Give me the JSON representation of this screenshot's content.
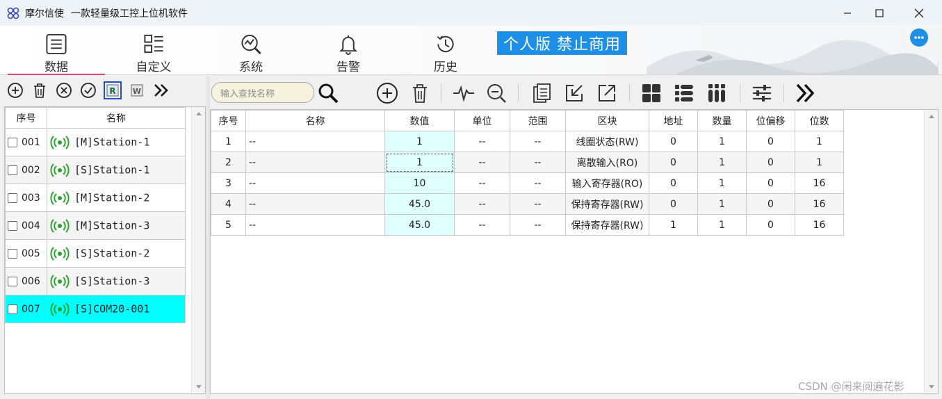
{
  "window": {
    "title": "摩尔信使",
    "subtitle": "一款轻量级工控上位机软件",
    "controls": [
      "minimize",
      "maximize",
      "close"
    ]
  },
  "nav": {
    "items": [
      {
        "label": "数据",
        "icon": "list-icon",
        "active": true
      },
      {
        "label": "自定义",
        "icon": "grid-list-icon",
        "active": false
      },
      {
        "label": "系统",
        "icon": "chart-search-icon",
        "active": false
      },
      {
        "label": "告警",
        "icon": "bell-icon",
        "active": false
      },
      {
        "label": "历史",
        "icon": "history-icon",
        "active": false
      }
    ],
    "badge": "个人版  禁止商用",
    "more_icon": "more-dots-icon"
  },
  "left_toolbar": [
    "add-icon",
    "delete-icon",
    "cancel-icon",
    "confirm-icon",
    "export-r-icon",
    "export-w-icon",
    "more-chevrons-icon"
  ],
  "left_table": {
    "headers": {
      "index": "序号",
      "name": "名称"
    },
    "rows": [
      {
        "index": "001",
        "name": "[M]Station-1"
      },
      {
        "index": "002",
        "name": "[S]Station-1"
      },
      {
        "index": "003",
        "name": "[M]Station-2"
      },
      {
        "index": "004",
        "name": "[M]Station-3"
      },
      {
        "index": "005",
        "name": "[S]Station-2"
      },
      {
        "index": "006",
        "name": "[S]Station-3"
      },
      {
        "index": "007",
        "name": "[S]COM20-001"
      }
    ],
    "selected_index": "007"
  },
  "right_toolbar": {
    "search_placeholder": "输入查找名称",
    "icons": [
      "search-icon",
      "add-icon",
      "delete-icon",
      "waveform-icon",
      "zoom-out-icon",
      "copy-icon",
      "import-icon",
      "export-icon",
      "tiles-icon",
      "rows-icon",
      "columns-icon",
      "settings-sliders-icon",
      "more-chevrons-icon"
    ]
  },
  "right_table": {
    "headers": [
      "序号",
      "名称",
      "数值",
      "单位",
      "范围",
      "区块",
      "地址",
      "数量",
      "位偏移",
      "位数"
    ],
    "rows": [
      [
        "1",
        "--",
        "1",
        "--",
        "--",
        "线圈状态(RW)",
        "0",
        "1",
        "0",
        "1"
      ],
      [
        "2",
        "--",
        "1",
        "--",
        "--",
        "离散输入(RO)",
        "0",
        "1",
        "0",
        "1"
      ],
      [
        "3",
        "--",
        "10",
        "--",
        "--",
        "输入寄存器(RO)",
        "0",
        "1",
        "0",
        "16"
      ],
      [
        "4",
        "--",
        "45.0",
        "--",
        "--",
        "保持寄存器(RW)",
        "0",
        "1",
        "0",
        "16"
      ],
      [
        "5",
        "--",
        "45.0",
        "--",
        "--",
        "保持寄存器(RW)",
        "1",
        "1",
        "0",
        "16"
      ]
    ]
  },
  "watermark": "CSDN @闲来阅遍花影",
  "colors": {
    "accent_blue": "#1e8fe6",
    "selected_row": "#00ffff",
    "value_cell": "#e0ffff",
    "signal_green": "#2aa52a",
    "active_tab_underline": "#e0457b"
  }
}
